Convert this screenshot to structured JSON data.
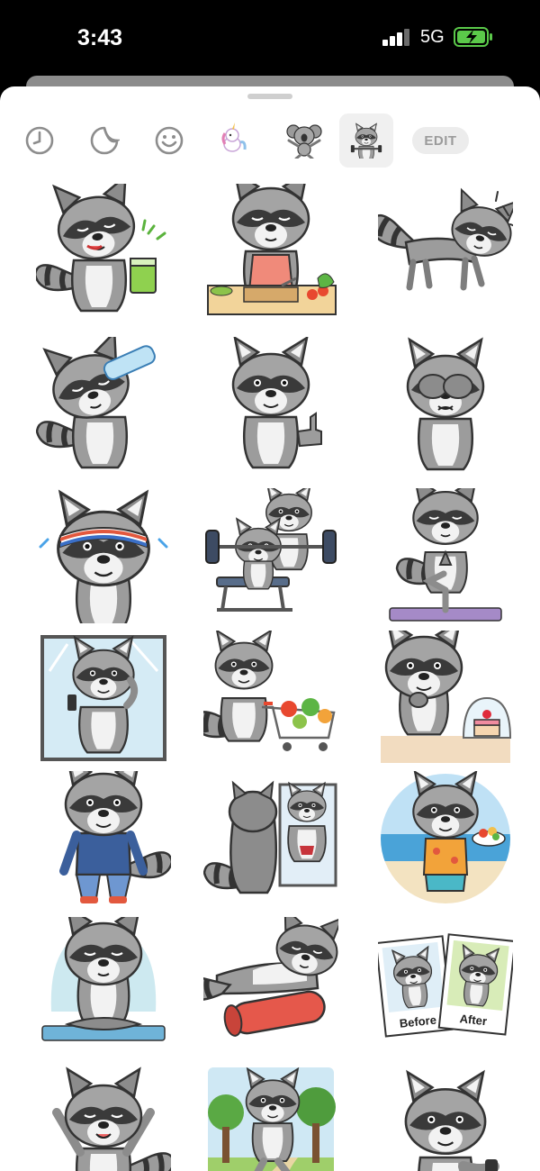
{
  "status_bar": {
    "time": "3:43",
    "network": "5G"
  },
  "tray": {
    "tabs": [
      {
        "name": "recents",
        "icon": "clock-icon"
      },
      {
        "name": "stickers",
        "icon": "sticker-peel-icon"
      },
      {
        "name": "emoji",
        "icon": "smiley-icon"
      },
      {
        "name": "unicorn-pack",
        "icon": "unicorn-icon"
      },
      {
        "name": "koala-pack",
        "icon": "koala-icon"
      },
      {
        "name": "raccoon-pack",
        "icon": "raccoon-icon",
        "selected": true
      }
    ],
    "edit_label": "EDIT"
  },
  "stickers": [
    {
      "id": "sour-juice"
    },
    {
      "id": "cooking-salad"
    },
    {
      "id": "sore-stretch"
    },
    {
      "id": "drinking-water"
    },
    {
      "id": "thumbs-up"
    },
    {
      "id": "facepalm"
    },
    {
      "id": "headband-sweat"
    },
    {
      "id": "bench-press"
    },
    {
      "id": "yoga-tree-pose"
    },
    {
      "id": "mirror-selfie"
    },
    {
      "id": "shopping-cart"
    },
    {
      "id": "cake-temptation"
    },
    {
      "id": "sport-suit"
    },
    {
      "id": "mirror-muscles"
    },
    {
      "id": "beach-fruit"
    },
    {
      "id": "meditation"
    },
    {
      "id": "foam-roller"
    },
    {
      "id": "before-after",
      "labels": [
        "Before",
        "After"
      ]
    },
    {
      "id": "cheering"
    },
    {
      "id": "forest-run"
    },
    {
      "id": "watch-check"
    }
  ],
  "colors": {
    "accent": "#5bc94a",
    "fur": "#9a9a9a",
    "mask": "#3d3d3d"
  }
}
